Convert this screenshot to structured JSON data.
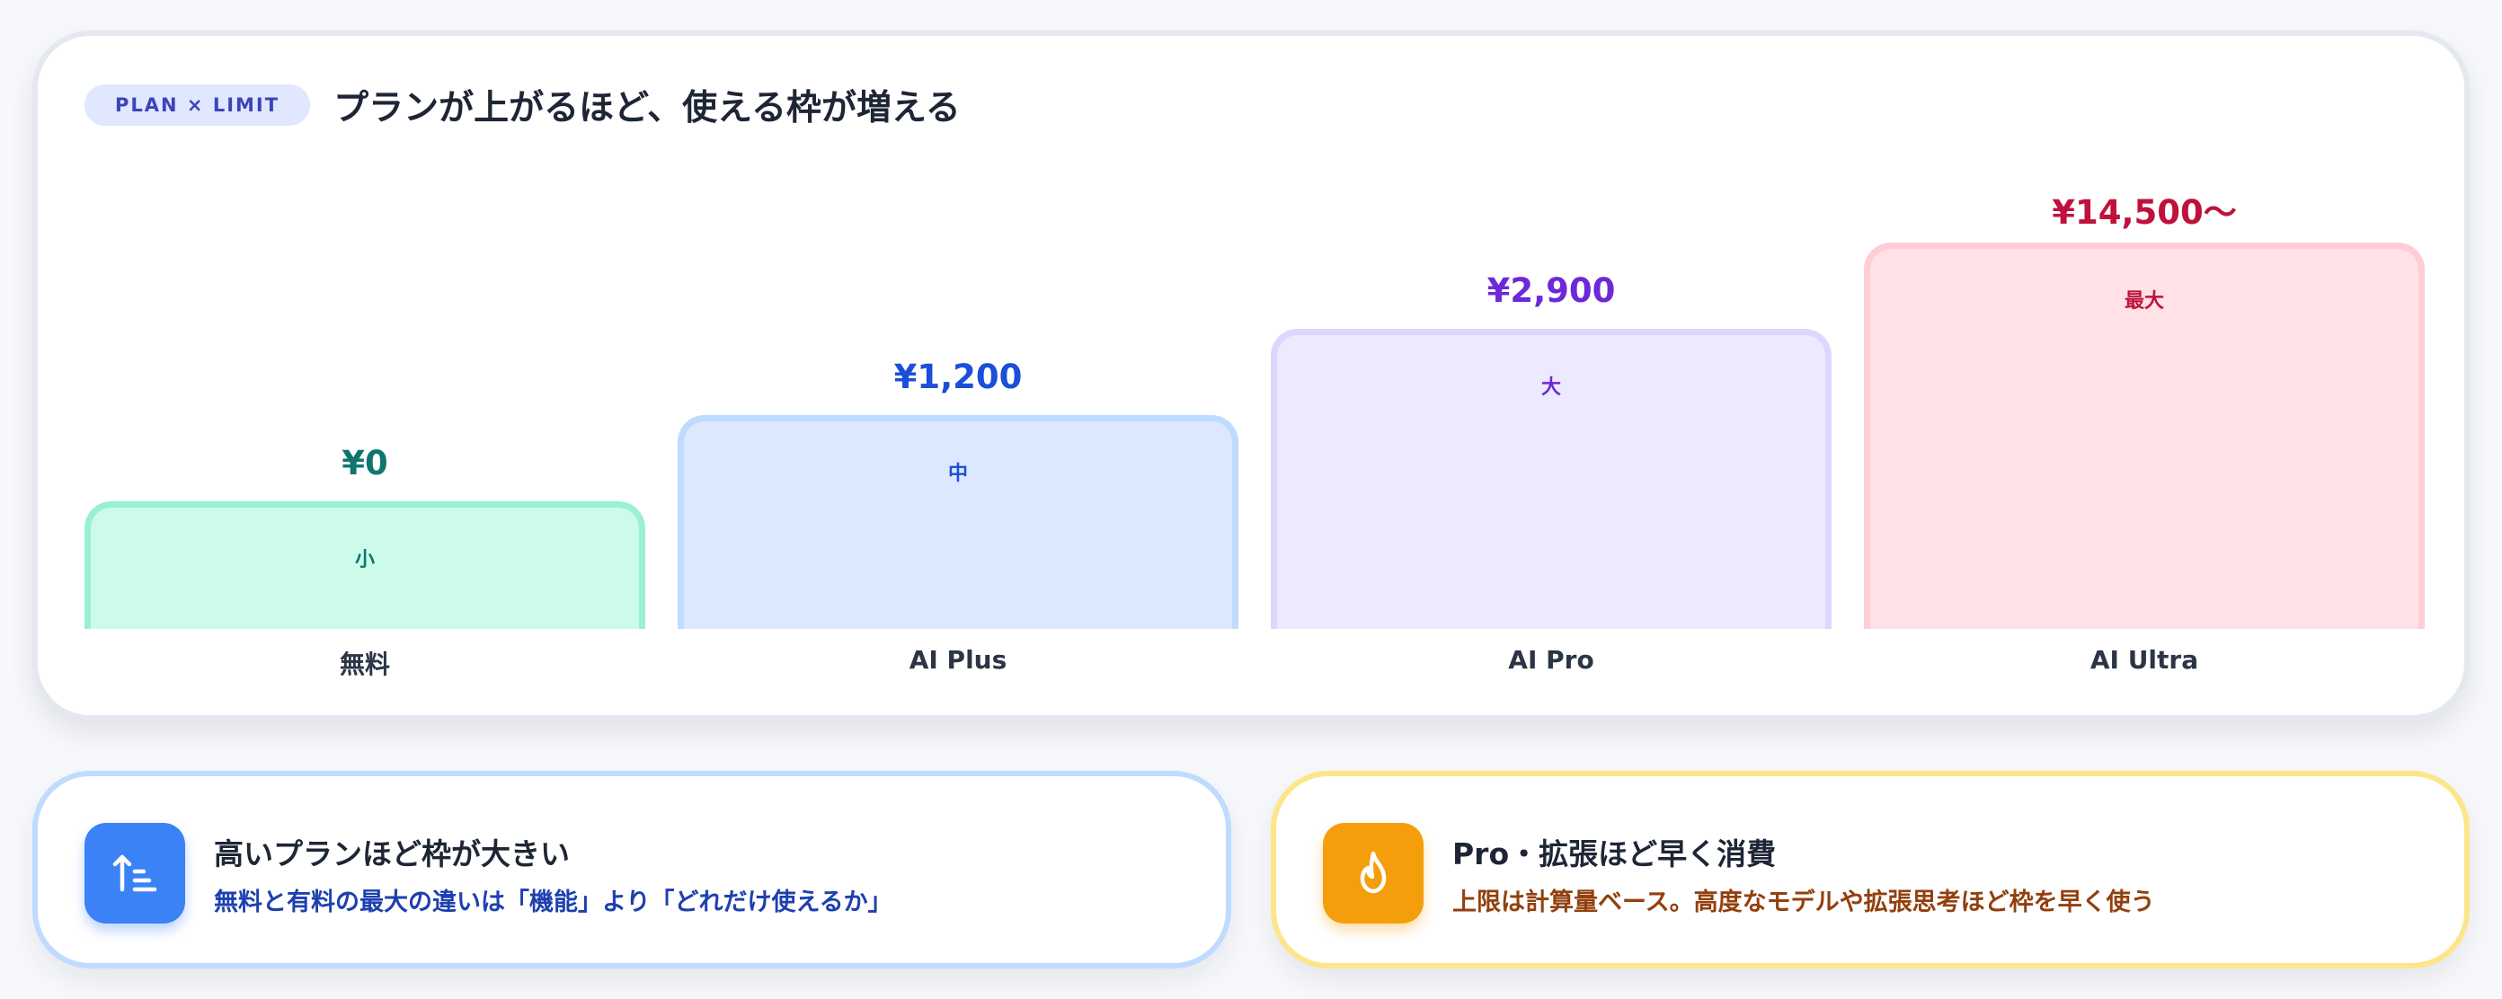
{
  "header": {
    "badge": "PLAN × LIMIT",
    "title": "プランが上がるほど、使える枠が増える"
  },
  "chart_data": {
    "type": "bar",
    "title": "プランが上がるほど、使える枠が増える",
    "categories": [
      "無料",
      "AI Plus",
      "AI Pro",
      "AI Ultra"
    ],
    "values": [
      1,
      2,
      3,
      4
    ],
    "level_labels": [
      "小",
      "中",
      "大",
      "最大"
    ],
    "price_labels": [
      "¥0",
      "¥1,200",
      "¥2,900",
      "¥14,500〜"
    ],
    "ylim": [
      0,
      4
    ],
    "grid": false,
    "colors": {
      "fills": [
        "#ccfbea",
        "#dbe8fe",
        "#ede9fe",
        "#ffe1e6"
      ],
      "borders": [
        "#99f0d6",
        "#bfdbfe",
        "#ddd6fe",
        "#fecdd5"
      ],
      "text": [
        "#0f766e",
        "#1d4ed8",
        "#6d28d9",
        "#be123c"
      ]
    }
  },
  "info_cards": [
    {
      "icon": "ascending-sort-icon",
      "title": "高いプランほど枠が大きい",
      "description": "無料と有料の最大の違いは「機能」より「どれだけ使えるか」",
      "accent": "#3b82f6",
      "border": "#bfdbfe",
      "desc_color": "#1e40af"
    },
    {
      "icon": "flame-icon",
      "title": "Pro・拡張ほど早く消費",
      "description": "上限は計算量ベース。高度なモデルや拡張思考ほど枠を早く使う",
      "accent": "#f59e0b",
      "border": "#fde68a",
      "desc_color": "#92400e"
    }
  ]
}
